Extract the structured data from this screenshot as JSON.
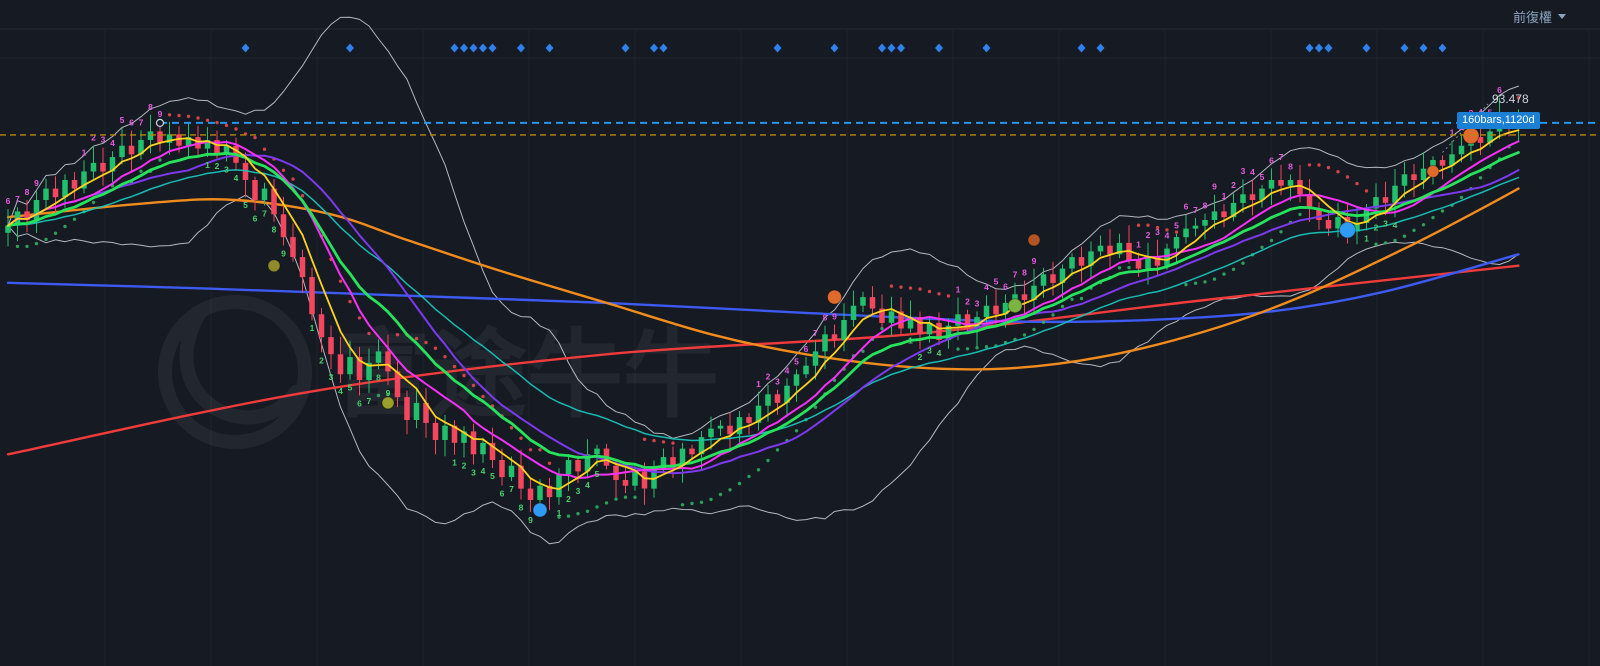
{
  "app": {
    "adjustment_label": "前復權"
  },
  "overlays": {
    "high_price_label": "93.478",
    "measure_badge": "160bars,1120d"
  },
  "colors": {
    "background": "#161a22",
    "candle_up": "#21c06d",
    "candle_down": "#f4465d",
    "ma_yellow": "#ffd21e",
    "ma_green": "#27e35c",
    "ma_magenta": "#f631f6",
    "ma_purple": "#7c3aed",
    "ma_teal": "#19c3b8",
    "ma_orange": "#f08c1d",
    "ma_blue": "#3d5af1",
    "ma_red": "#ef3b3b",
    "bollinger": "#cfd4dd",
    "diamond": "#2f80ed",
    "measure_line": "#2196f3",
    "alert_line": "#b8860b",
    "sar_up": "#2fae62",
    "sar_down": "#e5484d",
    "td_green": "#49d06e",
    "td_magenta": "#e85ae0"
  },
  "chart_data": {
    "type": "candlestick",
    "bars": 160,
    "ylim": [
      74.5,
      95.5
    ],
    "grid": {
      "vertical_spacing_px": 106,
      "horizontal_gridlines": false,
      "legend": "none",
      "y_axis_labels_visible": false
    },
    "closes": [
      89.0,
      89.5,
      89.2,
      89.9,
      90.3,
      90.0,
      90.6,
      90.3,
      90.9,
      91.2,
      90.9,
      91.4,
      91.8,
      91.5,
      92.0,
      92.3,
      91.9,
      92.2,
      91.8,
      92.1,
      91.7,
      92.0,
      91.5,
      91.8,
      91.2,
      90.6,
      89.9,
      90.3,
      89.4,
      88.6,
      87.9,
      87.2,
      85.9,
      85.1,
      84.5,
      83.8,
      84.4,
      83.6,
      84.2,
      84.6,
      83.9,
      83.0,
      82.2,
      82.8,
      82.1,
      81.5,
      82.0,
      81.4,
      81.8,
      81.0,
      81.4,
      80.8,
      80.2,
      80.6,
      79.8,
      79.4,
      79.9,
      79.5,
      80.3,
      80.8,
      80.4,
      81.0,
      81.2,
      80.6,
      80.1,
      79.9,
      80.4,
      79.8,
      80.5,
      80.9,
      80.6,
      81.2,
      81.0,
      81.6,
      81.9,
      82.0,
      81.7,
      82.3,
      82.1,
      82.7,
      83.1,
      82.8,
      83.4,
      83.8,
      84.1,
      84.6,
      85.2,
      85.0,
      85.7,
      86.2,
      86.5,
      86.1,
      85.6,
      86.0,
      85.4,
      85.8,
      85.2,
      85.6,
      85.0,
      85.5,
      85.9,
      85.4,
      85.8,
      86.2,
      85.9,
      86.3,
      86.6,
      86.4,
      86.9,
      87.3,
      87.0,
      87.5,
      87.9,
      87.6,
      88.1,
      88.3,
      88.0,
      88.4,
      87.8,
      87.5,
      87.9,
      87.6,
      88.2,
      88.6,
      88.9,
      89.0,
      89.2,
      89.5,
      89.3,
      89.8,
      90.1,
      89.9,
      90.3,
      90.6,
      90.4,
      90.6,
      90.1,
      89.6,
      89.2,
      88.9,
      89.3,
      88.8,
      89.1,
      89.6,
      90.0,
      89.8,
      90.4,
      90.8,
      90.6,
      91.0,
      91.3,
      91.1,
      91.5,
      91.8,
      92.1,
      91.9,
      92.3,
      92.6,
      92.4,
      92.5
    ],
    "high_label": {
      "price": 93.478,
      "text": "93.478"
    },
    "measure_line": {
      "price": 92.6,
      "start_bar": 16,
      "label": "160bars,1120d"
    },
    "alert_line": {
      "price": 92.18
    },
    "event_diamonds_bars": [
      25,
      36,
      47,
      48,
      49,
      50,
      51,
      54,
      57,
      65,
      68,
      69,
      81,
      87,
      92,
      93,
      94,
      98,
      103,
      113,
      115,
      137,
      138,
      139,
      143,
      147,
      149,
      151
    ],
    "signals": [
      {
        "bar": 28,
        "price": 87.6,
        "color": "#8f8a2a",
        "r": 6
      },
      {
        "bar": 40,
        "price": 82.8,
        "color": "#9aa02b",
        "r": 6
      },
      {
        "bar": 56,
        "price": 79.05,
        "color": "#2f9bf4",
        "r": 7
      },
      {
        "bar": 87,
        "price": 86.5,
        "color": "#e06a2b",
        "r": 7
      },
      {
        "bar": 106,
        "price": 86.2,
        "color": "#7cb342",
        "r": 7
      },
      {
        "bar": 108,
        "price": 88.5,
        "color": "#b35425",
        "r": 6
      },
      {
        "bar": 141,
        "price": 88.85,
        "color": "#2f9bf4",
        "r": 8
      },
      {
        "bar": 150,
        "price": 90.9,
        "color": "#e06a2b",
        "r": 6
      },
      {
        "bar": 154,
        "price": 92.15,
        "color": "#e06a2b",
        "r": 8
      }
    ],
    "td_sequences": [
      {
        "start": 0,
        "from": 6,
        "to": 9,
        "side": "above",
        "color": "#e85ae0"
      },
      {
        "start": 8,
        "from": 1,
        "to": 9,
        "side": "above",
        "color": "#e85ae0"
      },
      {
        "start": 21,
        "from": 1,
        "to": 9,
        "side": "below",
        "color": "#49d06e"
      },
      {
        "start": 32,
        "from": 1,
        "to": 9,
        "side": "below",
        "color": "#49d06e"
      },
      {
        "start": 47,
        "from": 1,
        "to": 9,
        "side": "below",
        "color": "#49d06e"
      },
      {
        "start": 58,
        "from": 1,
        "to": 5,
        "side": "below",
        "color": "#49d06e"
      },
      {
        "start": 79,
        "from": 1,
        "to": 9,
        "side": "above",
        "color": "#e85ae0"
      },
      {
        "start": 95,
        "from": 1,
        "to": 4,
        "side": "below",
        "color": "#49d06e"
      },
      {
        "start": 100,
        "from": 1,
        "to": 9,
        "side": "above",
        "color": "#e85ae0"
      },
      {
        "start": 119,
        "from": 1,
        "to": 9,
        "side": "above",
        "color": "#e85ae0"
      },
      {
        "start": 128,
        "from": 1,
        "to": 8,
        "side": "above",
        "color": "#e85ae0"
      },
      {
        "start": 143,
        "from": 1,
        "to": 4,
        "side": "below",
        "color": "#49d06e"
      },
      {
        "start": 152,
        "from": 1,
        "to": 6,
        "side": "above",
        "color": "#e85ae0"
      }
    ],
    "ma_windows": {
      "yellow_sma": 5,
      "magenta_sma": 10,
      "purple_sma": 20,
      "green_ema": 15,
      "teal_ema": 30,
      "boll": {
        "n": 20,
        "k": 2.5
      }
    },
    "long_ma": {
      "orange": [
        [
          0,
          89.3
        ],
        [
          15,
          89.8
        ],
        [
          24,
          89.9
        ],
        [
          34,
          89.4
        ],
        [
          42,
          88.5
        ],
        [
          52,
          87.4
        ],
        [
          63,
          86.3
        ],
        [
          74,
          85.2
        ],
        [
          84,
          84.5
        ],
        [
          95,
          84.05
        ],
        [
          105,
          84.0
        ],
        [
          115,
          84.4
        ],
        [
          126,
          85.3
        ],
        [
          136,
          86.5
        ],
        [
          147,
          88.2
        ],
        [
          154,
          89.4
        ],
        [
          159,
          90.3
        ]
      ],
      "blue": [
        [
          0,
          87.0
        ],
        [
          21,
          86.8
        ],
        [
          42,
          86.55
        ],
        [
          63,
          86.3
        ],
        [
          84,
          85.95
        ],
        [
          105,
          85.65
        ],
        [
          120,
          85.7
        ],
        [
          133,
          86.0
        ],
        [
          145,
          86.7
        ],
        [
          159,
          88.0
        ]
      ],
      "red": [
        [
          0,
          81.0
        ],
        [
          32,
          83.2
        ],
        [
          63,
          84.5
        ],
        [
          95,
          85.2
        ],
        [
          126,
          86.4
        ],
        [
          159,
          87.6
        ]
      ]
    },
    "watermark_text": "富途牛牛"
  }
}
